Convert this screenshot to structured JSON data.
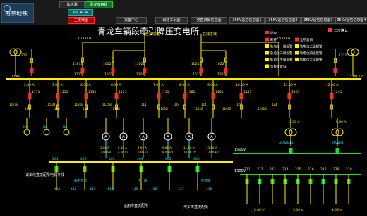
{
  "app": {
    "logo_text": "南京地铁"
  },
  "top_tabs": {
    "row1": [
      {
        "label": "仙林湖"
      },
      {
        "label": "青龙车辆段"
      }
    ],
    "row2": [
      {
        "label": "PSCADA"
      }
    ],
    "row3": [
      {
        "label": "主接线图"
      },
      {
        "label": "报警中心"
      },
      {
        "label": "网络工况图"
      },
      {
        "label": "交直流屏信息图"
      },
      {
        "label": "35KV遥信信息图1"
      },
      {
        "label": "35KV遥信信息图2"
      },
      {
        "label": "35KV遥信信息图3"
      },
      {
        "label": "35KV遥信信息图4"
      }
    ]
  },
  "station_title": "青龙车辆段牵引降压变电所",
  "legend": {
    "items": [
      "闭合",
      "断开",
      "全所复归",
      "轨电位一级报警",
      "轨电位二级报警",
      "轨电位三级报警",
      "轨电位四级报警",
      "轨电位五级报警",
      "轨电位六级报警",
      "负极柜复归"
    ],
    "lock_label": "二次确认"
  },
  "colors": {
    "bus": "#ffee00",
    "breaker_on": "#ff2a2a",
    "breaker_off": "#22dd22",
    "text_cyan": "#22e0ff",
    "text_yellow": "#ffee00"
  },
  "incoming": {
    "left_label": "左线进线",
    "right_label": "右线进线",
    "top_labels": [
      "10.00 A",
      "15.00 A"
    ]
  },
  "switches_top": {
    "left_transformer": {
      "id": "1311",
      "label": "1311"
    },
    "right_transformer": {
      "id": "1321",
      "label": "1321"
    },
    "row_a": [
      "1301D",
      "1002",
      "1302D",
      "1021D",
      "1022"
    ],
    "row_b": [
      "1311",
      "1301",
      "1302",
      "1021",
      "1321"
    ]
  },
  "bus_35kv": {
    "left_voltage": "1.00 kV",
    "right_voltage": "3.00 kV"
  },
  "feeders": {
    "currents": [
      "2.00 A",
      "3.00 A",
      "4.00 A",
      "6.00 A",
      "7.00 A",
      "8.00 A",
      "9.00 A",
      "10.00 A",
      "11.00 A",
      "12.00 A"
    ],
    "ids": [
      "1171",
      "1151",
      "1131",
      "1121",
      "1111",
      "1181",
      "1161",
      "1141",
      "1201",
      "1241"
    ],
    "sub_ids": [
      "1171B",
      "117",
      "1151D",
      "115",
      "1131B",
      "113",
      "1121B",
      "1111B",
      "111",
      "1161B",
      "116",
      "1141B",
      "114",
      "1201B",
      "120",
      "1241B",
      "124"
    ]
  },
  "left_branch": {
    "labels": [
      "NO.",
      "NO.",
      "NO."
    ],
    "caption": "试车线直流配所电源专线"
  },
  "transformers": {
    "ids": [
      "2011",
      "2021"
    ],
    "labels": [
      "202",
      "201"
    ]
  },
  "dc_bus_left": {
    "values": [
      "3.00 A",
      "5.00 A",
      "7.00 A",
      "9.00 A",
      "11.00 A",
      "13.00 A"
    ],
    "kv": [
      "2.00 kV",
      "4.00 kV",
      "6.00 kV",
      "8.00 kV",
      "10.00 kV",
      "12.00 kV"
    ],
    "ids": [
      "401",
      "402",
      "403",
      "404",
      "405",
      "406"
    ],
    "sub_ids": [
      "411",
      "412",
      "413",
      "414",
      "415",
      "416",
      "417",
      "418"
    ],
    "captions": [
      "备用直流",
      "出厂库",
      "检修库"
    ],
    "bottom_labels": [
      "运用库直流配所",
      "汽车库直流配所"
    ]
  },
  "dc_bus_right": {
    "voltage_label": "1500V",
    "voltage_label2": "1500V",
    "ids": [
      "211",
      "212",
      "213",
      "214",
      "215",
      "216",
      "217",
      "218",
      "219"
    ],
    "values": [
      "2.00 V",
      "3.00 V",
      "4.00 V"
    ]
  },
  "ptvs": [
    "3.00 A",
    "5.00 A"
  ]
}
